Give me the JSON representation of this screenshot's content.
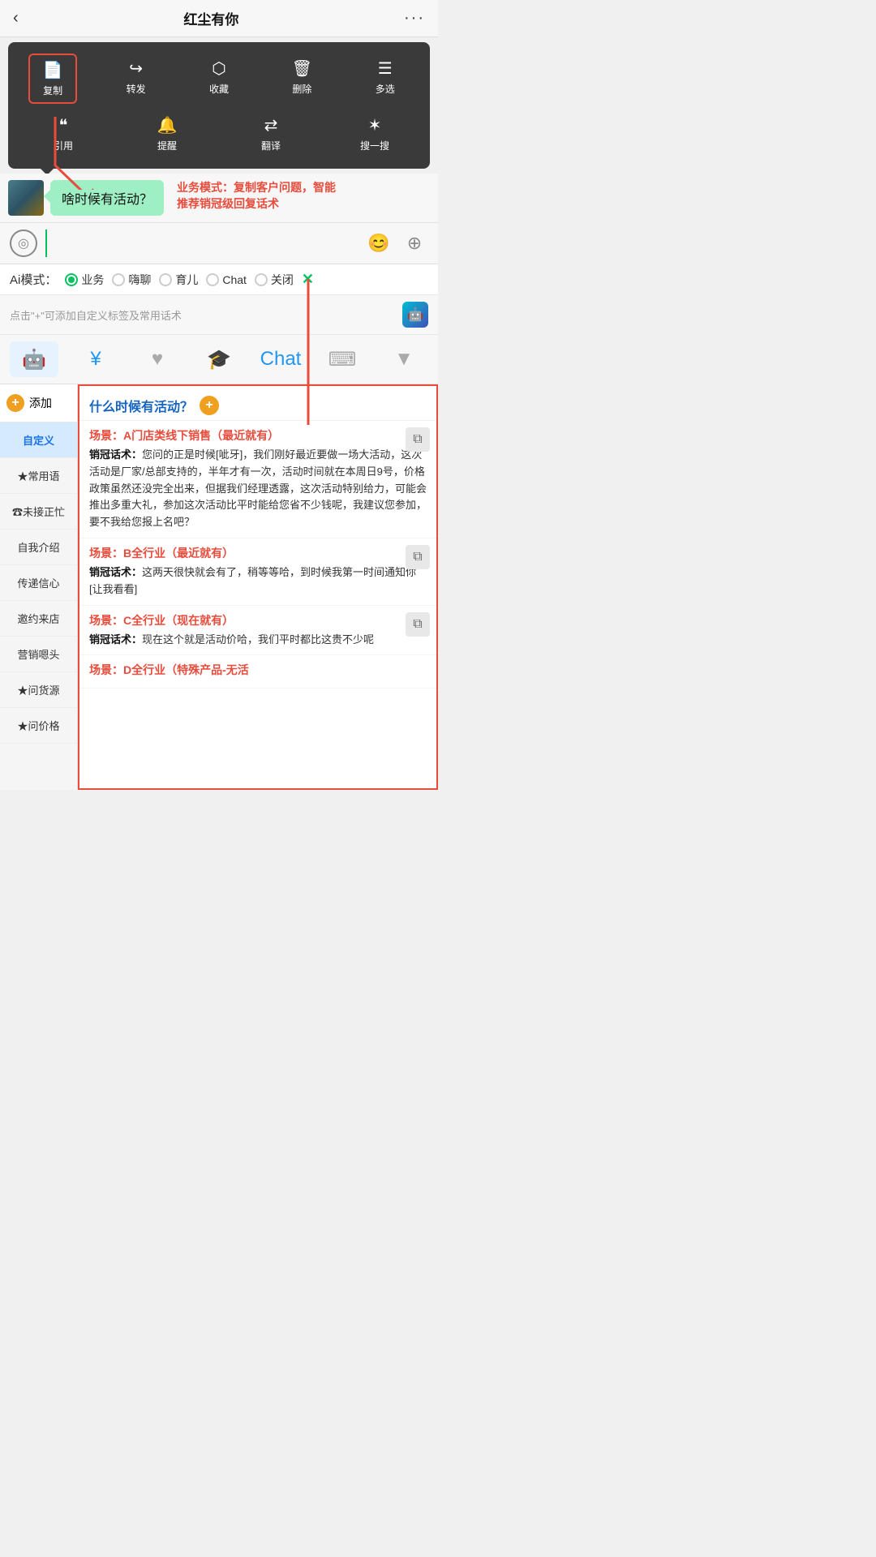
{
  "topNav": {
    "backIcon": "‹",
    "title": "红尘有你",
    "moreIcon": "···"
  },
  "contextMenu": {
    "row1": [
      {
        "icon": "📄",
        "label": "复制",
        "selected": true
      },
      {
        "icon": "↪",
        "label": "转发",
        "selected": false
      },
      {
        "icon": "⬡",
        "label": "收藏",
        "selected": false
      },
      {
        "icon": "🗑",
        "label": "删除",
        "selected": false
      },
      {
        "icon": "☰",
        "label": "多选",
        "selected": false
      }
    ],
    "row2": [
      {
        "icon": "❝",
        "label": "引用",
        "selected": false
      },
      {
        "icon": "🔔",
        "label": "提醒",
        "selected": false
      },
      {
        "icon": "⇄",
        "label": "翻译",
        "selected": false
      },
      {
        "icon": "✶",
        "label": "搜一搜",
        "selected": false
      }
    ]
  },
  "chatBubble": {
    "text": "啥时候有活动？"
  },
  "annotationText": "业务模式：复制客户问题，智能推荐销冠级回复话术",
  "inputArea": {
    "voiceIcon": "◎",
    "placeholder": "",
    "emojiLabel": "😊",
    "plusLabel": "+"
  },
  "aiModeBar": {
    "label": "Ai模式：",
    "options": [
      {
        "id": "business",
        "label": "业务",
        "active": true
      },
      {
        "id": "casual",
        "label": "嗨聊",
        "active": false
      },
      {
        "id": "parenting",
        "label": "育儿",
        "active": false
      },
      {
        "id": "chat",
        "label": "Chat",
        "active": false
      },
      {
        "id": "off",
        "label": "关闭",
        "active": false
      }
    ],
    "closeIcon": "✕"
  },
  "hintBar": {
    "text": "点击\"+\"可添加自定义标签及常用话术"
  },
  "toolbar": {
    "items": [
      {
        "id": "chatbot",
        "icon": "🤖",
        "active": true,
        "color": "blue"
      },
      {
        "id": "money",
        "icon": "¥",
        "active": false,
        "color": "blue"
      },
      {
        "id": "heart",
        "icon": "♥",
        "active": false,
        "color": "gray"
      },
      {
        "id": "hat",
        "icon": "🎓",
        "active": false,
        "color": "gray"
      },
      {
        "id": "chat2",
        "icon": "Chat",
        "active": false,
        "color": "blue"
      },
      {
        "id": "keyboard",
        "icon": "⌨",
        "active": false,
        "color": "gray"
      },
      {
        "id": "down",
        "icon": "▼",
        "active": false,
        "color": "gray"
      }
    ]
  },
  "sidebar": {
    "addLabel": "添加",
    "items": [
      {
        "id": "custom",
        "label": "自定义",
        "active": true
      },
      {
        "id": "common",
        "label": "★常用语",
        "active": false
      },
      {
        "id": "missed",
        "label": "☎未接正忙",
        "active": false
      },
      {
        "id": "intro",
        "label": "自我介绍",
        "active": false
      },
      {
        "id": "transfer",
        "label": "传递信心",
        "active": false
      },
      {
        "id": "invite",
        "label": "邀约来店",
        "active": false
      },
      {
        "id": "marketing",
        "label": "营销嗯头",
        "active": false
      },
      {
        "id": "source",
        "label": "★问货源",
        "active": false
      },
      {
        "id": "price",
        "label": "★问价格",
        "active": false
      }
    ]
  },
  "rightContent": {
    "questionTitle": "什么时候有活动？",
    "scenes": [
      {
        "id": "A",
        "sceneLabel": "场景：A门店类线下销售（最近就有）",
        "salesLabel": "销冠话术：",
        "salesText": "您问的正是时候[呲牙]，我们刚好最近要做一场大活动，这次活动是厂家/总部支持的，半年才有一次，活动时间就在本周日9号，价格政策虽然还没完全出来，但据我们经理透露，这次活动特别给力，可能会推出多重大礼，参加这次活动比平时能给您省不少钱呢，我建议您参加，要不我给您报上名吧？",
        "hasCopyBtn": true
      },
      {
        "id": "B",
        "sceneLabel": "场景：B全行业（最近就有）",
        "salesLabel": "销冠话术：",
        "salesText": "这两天很快就会有了，稍等等哈，到时候我第一时间通知你[让我看看]",
        "hasCopyBtn": true
      },
      {
        "id": "C",
        "sceneLabel": "场景：C全行业（现在就有）",
        "salesLabel": "销冠话术：",
        "salesText": "现在这个就是活动价哈，我们平时都比这贵不少呢",
        "hasCopyBtn": true
      },
      {
        "id": "D",
        "sceneLabel": "场景：D全行业（特殊产品-无活",
        "salesLabel": "",
        "salesText": "",
        "hasCopyBtn": false
      }
    ]
  }
}
